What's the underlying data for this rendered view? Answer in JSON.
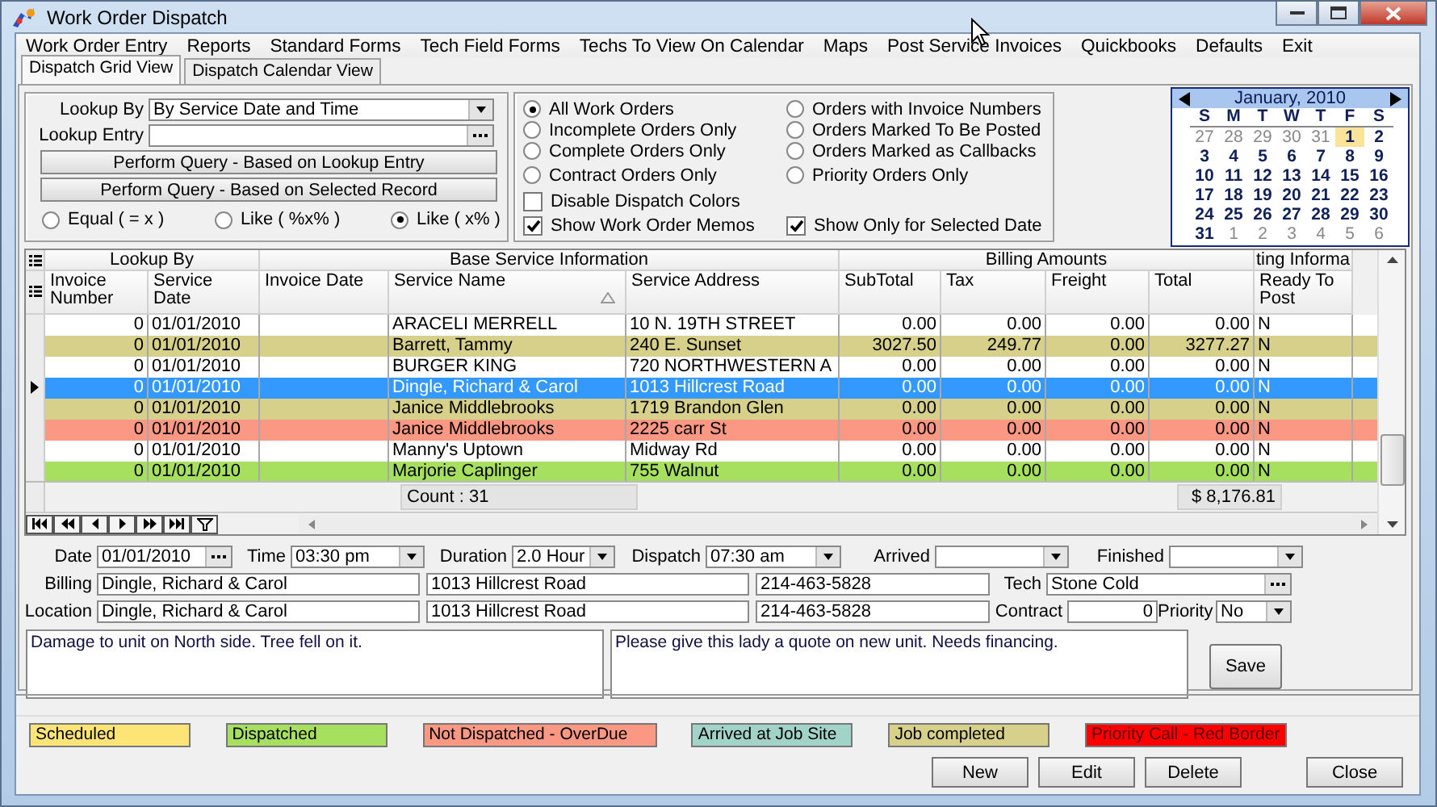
{
  "window": {
    "title": "Work Order Dispatch"
  },
  "menu": [
    "Work Order Entry",
    "Reports",
    "Standard Forms",
    "Tech Field Forms",
    "Techs To View On Calendar",
    "Maps",
    "Post Service Invoices",
    "Quickbooks",
    "Defaults",
    "Exit"
  ],
  "tabs": [
    {
      "label": "Dispatch Grid View",
      "selected": true
    },
    {
      "label": "Dispatch Calendar View",
      "selected": false
    }
  ],
  "lookup": {
    "by_label": "Lookup By",
    "by_value": "By Service Date and Time",
    "entry_label": "Lookup Entry",
    "buttons": [
      "Perform Query - Based on Lookup Entry",
      "Perform Query - Based on Selected Record"
    ],
    "match_modes": [
      {
        "label": "Equal ( = x )",
        "selected": false
      },
      {
        "label": "Like ( %x% )",
        "selected": false
      },
      {
        "label": "Like ( x% )",
        "selected": true
      }
    ]
  },
  "filters": {
    "columns": [
      [
        {
          "kind": "radio",
          "label": "All Work Orders",
          "selected": true
        },
        {
          "kind": "radio",
          "label": "Incomplete Orders Only",
          "selected": false
        },
        {
          "kind": "radio",
          "label": "Complete Orders Only",
          "selected": false
        },
        {
          "kind": "radio",
          "label": "Contract Orders Only",
          "selected": false
        },
        {
          "kind": "checkbox",
          "label": "Disable Dispatch Colors",
          "checked": false
        },
        {
          "kind": "checkbox",
          "label": "Show Work Order Memos",
          "checked": true
        }
      ],
      [
        {
          "kind": "radio",
          "label": "Orders with Invoice Numbers",
          "selected": false
        },
        {
          "kind": "radio",
          "label": "Orders Marked To Be Posted",
          "selected": false
        },
        {
          "kind": "radio",
          "label": "Orders Marked as Callbacks",
          "selected": false
        },
        {
          "kind": "radio",
          "label": "Priority Orders Only",
          "selected": false
        },
        {
          "kind": "checkbox",
          "label": "Show Only for Selected Date",
          "checked": true
        }
      ]
    ]
  },
  "calendar": {
    "month": "January, 2010",
    "weekdays": [
      "S",
      "M",
      "T",
      "W",
      "T",
      "F",
      "S"
    ],
    "days": [
      {
        "label": "27",
        "other_month": true,
        "selected": false
      },
      {
        "label": "28",
        "other_month": true,
        "selected": false
      },
      {
        "label": "29",
        "other_month": true,
        "selected": false
      },
      {
        "label": "30",
        "other_month": true,
        "selected": false
      },
      {
        "label": "31",
        "other_month": true,
        "selected": false
      },
      {
        "label": "1",
        "other_month": false,
        "selected": true
      },
      {
        "label": "2",
        "other_month": false,
        "selected": false
      },
      {
        "label": "3",
        "other_month": false,
        "selected": false
      },
      {
        "label": "4",
        "other_month": false,
        "selected": false
      },
      {
        "label": "5",
        "other_month": false,
        "selected": false
      },
      {
        "label": "6",
        "other_month": false,
        "selected": false
      },
      {
        "label": "7",
        "other_month": false,
        "selected": false
      },
      {
        "label": "8",
        "other_month": false,
        "selected": false
      },
      {
        "label": "9",
        "other_month": false,
        "selected": false
      },
      {
        "label": "10",
        "other_month": false,
        "selected": false
      },
      {
        "label": "11",
        "other_month": false,
        "selected": false
      },
      {
        "label": "12",
        "other_month": false,
        "selected": false
      },
      {
        "label": "13",
        "other_month": false,
        "selected": false
      },
      {
        "label": "14",
        "other_month": false,
        "selected": false
      },
      {
        "label": "15",
        "other_month": false,
        "selected": false
      },
      {
        "label": "16",
        "other_month": false,
        "selected": false
      },
      {
        "label": "17",
        "other_month": false,
        "selected": false
      },
      {
        "label": "18",
        "other_month": false,
        "selected": false
      },
      {
        "label": "19",
        "other_month": false,
        "selected": false
      },
      {
        "label": "20",
        "other_month": false,
        "selected": false
      },
      {
        "label": "21",
        "other_month": false,
        "selected": false
      },
      {
        "label": "22",
        "other_month": false,
        "selected": false
      },
      {
        "label": "23",
        "other_month": false,
        "selected": false
      },
      {
        "label": "24",
        "other_month": false,
        "selected": false
      },
      {
        "label": "25",
        "other_month": false,
        "selected": false
      },
      {
        "label": "26",
        "other_month": false,
        "selected": false
      },
      {
        "label": "27",
        "other_month": false,
        "selected": false
      },
      {
        "label": "28",
        "other_month": false,
        "selected": false
      },
      {
        "label": "29",
        "other_month": false,
        "selected": false
      },
      {
        "label": "30",
        "other_month": false,
        "selected": false
      },
      {
        "label": "31",
        "other_month": false,
        "selected": false
      },
      {
        "label": "1",
        "other_month": true,
        "selected": false
      },
      {
        "label": "2",
        "other_month": true,
        "selected": false
      },
      {
        "label": "3",
        "other_month": true,
        "selected": false
      },
      {
        "label": "4",
        "other_month": true,
        "selected": false
      },
      {
        "label": "5",
        "other_month": true,
        "selected": false
      },
      {
        "label": "6",
        "other_month": true,
        "selected": false
      }
    ]
  },
  "grid": {
    "column_groups": [
      {
        "label": "Lookup By",
        "columns": [
          {
            "label": "Invoice Number"
          },
          {
            "label": "Service Date"
          }
        ]
      },
      {
        "label": "Base Service Information",
        "columns": [
          {
            "label": "Invoice Date"
          },
          {
            "label": "Service Name",
            "sorted": true
          },
          {
            "label": "Service Address"
          }
        ]
      },
      {
        "label": "Billing Amounts",
        "columns": [
          {
            "label": "SubTotal"
          },
          {
            "label": "Tax"
          },
          {
            "label": "Freight"
          },
          {
            "label": "Total"
          }
        ]
      },
      {
        "label": "ting Informa",
        "columns": [
          {
            "label": "Ready To Post"
          }
        ]
      }
    ],
    "rows": [
      {
        "color": "#ffffff",
        "selected": false,
        "cells": [
          "0",
          "01/01/2010",
          null,
          "ARACELI MERRELL",
          "10 N. 19TH STREET",
          "0.00",
          "0.00",
          "0.00",
          "0.00",
          "N"
        ]
      },
      {
        "color": "#d6d08a",
        "selected": false,
        "cells": [
          "0",
          "01/01/2010",
          null,
          "Barrett, Tammy",
          "240 E. Sunset",
          "3027.50",
          "249.77",
          "0.00",
          "3277.27",
          "N"
        ]
      },
      {
        "color": "#ffffff",
        "selected": false,
        "cells": [
          "0",
          "01/01/2010",
          null,
          "BURGER KING",
          "720 NORTHWESTERN A",
          "0.00",
          "0.00",
          "0.00",
          "0.00",
          "N"
        ]
      },
      {
        "selected": true,
        "cells": [
          "0",
          "01/01/2010",
          null,
          "Dingle, Richard & Carol",
          "1013 Hillcrest Road",
          "0.00",
          "0.00",
          "0.00",
          "0.00",
          "N"
        ]
      },
      {
        "color": "#d6d08a",
        "selected": false,
        "cells": [
          "0",
          "01/01/2010",
          null,
          "Janice Middlebrooks",
          "1719 Brandon Glen",
          "0.00",
          "0.00",
          "0.00",
          "0.00",
          "N"
        ]
      },
      {
        "color": "#fa9883",
        "selected": false,
        "cells": [
          "0",
          "01/01/2010",
          null,
          "Janice Middlebrooks",
          "2225 carr St",
          "0.00",
          "0.00",
          "0.00",
          "0.00",
          "N"
        ]
      },
      {
        "color": "#ffffff",
        "selected": false,
        "cells": [
          "0",
          "01/01/2010",
          null,
          "Manny's Uptown",
          "Midway Rd",
          "0.00",
          "0.00",
          "0.00",
          "0.00",
          "N"
        ]
      },
      {
        "color": "#a6e05e",
        "selected": false,
        "cells": [
          "0",
          "01/01/2010",
          null,
          "Marjorie Caplinger",
          "755 Walnut",
          "0.00",
          "0.00",
          "0.00",
          "0.00",
          "N"
        ]
      }
    ],
    "footer": {
      "count": "Count : 31",
      "total": "$ 8,176.81"
    }
  },
  "details": {
    "date": {
      "label": "Date",
      "value": "01/01/2010"
    },
    "time": {
      "label": "Time",
      "value": "03:30 pm"
    },
    "duration": {
      "label": "Duration",
      "value": "2.0 Hour"
    },
    "dispatch": {
      "label": "Dispatch",
      "value": "07:30 am"
    },
    "arrived": {
      "label": "Arrived"
    },
    "finished": {
      "label": "Finished"
    },
    "billing": {
      "label": "Billing",
      "name": "Dingle, Richard & Carol",
      "address": "1013 Hillcrest Road",
      "phone": "214-463-5828"
    },
    "tech": {
      "label": "Tech",
      "value": "Stone Cold"
    },
    "location": {
      "label": "Location",
      "name": "Dingle, Richard & Carol",
      "address": "1013 Hillcrest Road",
      "phone": "214-463-5828"
    },
    "contract": {
      "label": "Contract",
      "value": "0"
    },
    "priority": {
      "label": "Priority",
      "value": "No"
    },
    "memo": "Damage to unit on North side.  Tree fell on it.",
    "notes": "Please give this lady a quote on new unit.  Needs financing.",
    "save_button": "Save"
  },
  "legend": [
    {
      "label": "Scheduled",
      "color": "#fce576"
    },
    {
      "label": "Dispatched",
      "color": "#a6e05e"
    },
    {
      "label": "Not Dispatched - OverDue",
      "color": "#fa9883"
    },
    {
      "label": "Arrived at Job Site",
      "color": "#a2d3c9"
    },
    {
      "label": "Job completed",
      "color": "#d6d08a"
    },
    {
      "label": "Priority Call - Red Border",
      "color": "#ff0000"
    }
  ],
  "buttons": [
    "New",
    "Edit",
    "Delete",
    "Close"
  ]
}
